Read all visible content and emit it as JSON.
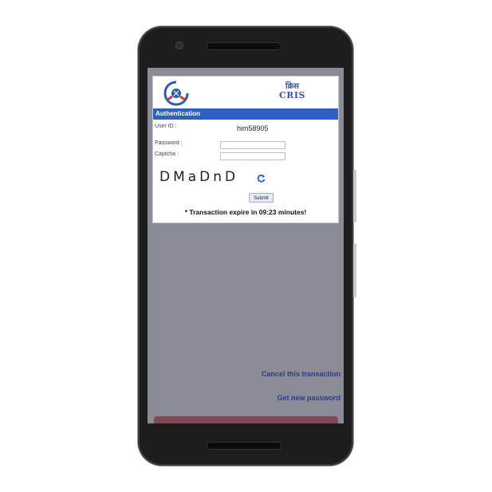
{
  "logos": {
    "irctc_icon": "irctc-logo-icon",
    "cris_hindi": "क्रिस",
    "cris_text": "CRIS"
  },
  "auth": {
    "header": "Authentication",
    "user_id_label": "User ID :",
    "user_id_value": "him58905",
    "password_label": "Password :",
    "password_value": "",
    "captcha_label": "Captcha :",
    "captcha_value": "",
    "captcha_text": "DMaDnD",
    "refresh_icon": "refresh-icon",
    "submit_label": "Submit",
    "expire_text": "* Transaction expire in 09:23 minutes!"
  },
  "links": {
    "cancel": "Cancel this transaction",
    "new_password": "Get new password"
  },
  "colors": {
    "header_bg": "#2f5fc0",
    "overlay_bg": "#8a8b95",
    "link": "#2a3d8f",
    "bottom_bar": "#7f4a55"
  }
}
